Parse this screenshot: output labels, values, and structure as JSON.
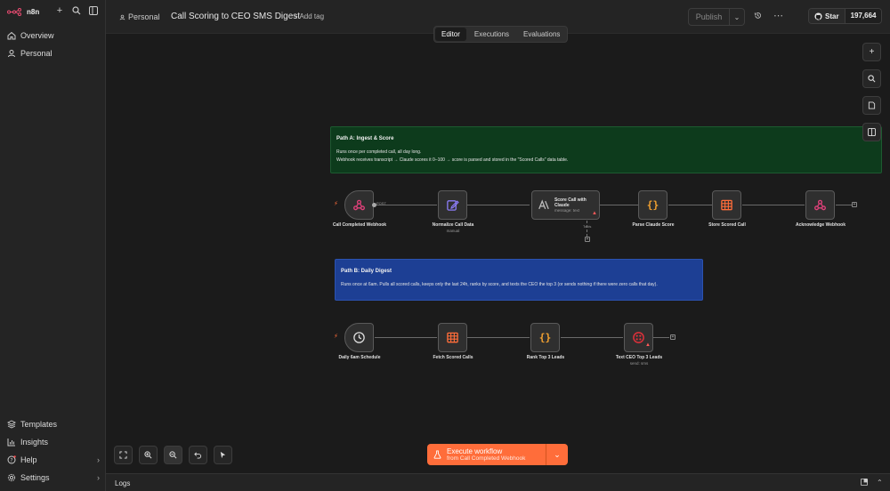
{
  "app": {
    "logo_text": "n8n"
  },
  "sidebar": {
    "top_items": [
      {
        "label": "Overview",
        "icon": "home-icon"
      },
      {
        "label": "Personal",
        "icon": "user-icon"
      }
    ],
    "bottom_items": [
      {
        "label": "Templates",
        "icon": "templates-icon"
      },
      {
        "label": "Insights",
        "icon": "insights-icon"
      },
      {
        "label": "Help",
        "icon": "help-icon"
      },
      {
        "label": "Settings",
        "icon": "gear-icon"
      }
    ]
  },
  "header": {
    "project": "Personal",
    "workflow_name": "Call Scoring to CEO SMS Digest",
    "add_tag": "+ Add tag",
    "publish": "Publish",
    "github_star": "Star",
    "github_count": "197,664"
  },
  "tabs": [
    {
      "label": "Editor",
      "active": true
    },
    {
      "label": "Executions",
      "active": false
    },
    {
      "label": "Evaluations",
      "active": false
    }
  ],
  "stickies": {
    "a": {
      "title": "Path A: Ingest & Score",
      "line1": "Runs once per completed call, all day long.",
      "line2": "Webhook receives transcript → Claude scores it 0–100 → score is parsed and stored in the \"Scored Calls\" data table.",
      "color": "#0d3b1c"
    },
    "b": {
      "title": "Path B: Daily Digest",
      "line1": "Runs once at 6am. Pulls all scored calls, keeps only the last 24h, ranks by score, and texts the CEO the top 3 (or sends nothing if there were zero calls that day).",
      "color": "#1d3f94"
    }
  },
  "nodes": {
    "webhook": {
      "label": "Call Completed Webhook",
      "port": "POST"
    },
    "normalize": {
      "label": "Normalize Call Data",
      "sub": "manual"
    },
    "claude": {
      "label": "Score Call with Claude",
      "sub": "message: text",
      "port": "Tools"
    },
    "parse": {
      "label": "Parse Claude Score"
    },
    "store": {
      "label": "Store Scored Call"
    },
    "ack": {
      "label": "Acknowledge Webhook"
    },
    "schedule": {
      "label": "Daily 6am Schedule"
    },
    "fetch": {
      "label": "Fetch Scored Calls"
    },
    "rank": {
      "label": "Rank Top 3 Leads"
    },
    "sms": {
      "label": "Text CEO Top 3 Leads",
      "sub": "send: sms"
    }
  },
  "execute": {
    "title": "Execute workflow",
    "sub": "from Call Completed Webhook"
  },
  "logs": {
    "label": "Logs"
  },
  "colors": {
    "accent": "#ff6d3a",
    "webhook_pink": "#e0407a",
    "edit_purple": "#8b7cf6",
    "code_orange": "#f0a030",
    "table_orange": "#ff6d3a",
    "twilio_red": "#e0303a"
  }
}
